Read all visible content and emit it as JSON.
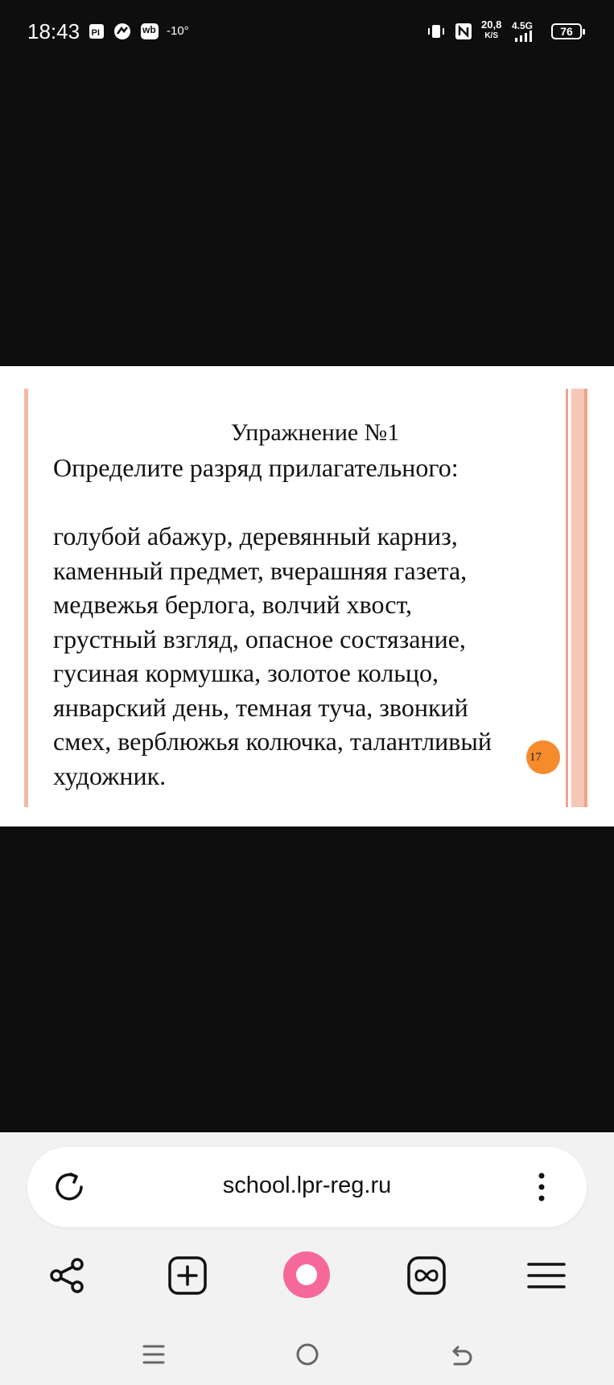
{
  "status_bar": {
    "time": "18:43",
    "notif_icons": [
      "pdf-app-icon",
      "sync-app-icon",
      "wb-app-icon"
    ],
    "wb_label": "wb",
    "temperature": "-10°",
    "speed_value": "20,8",
    "speed_unit": "K/S",
    "network": "4.5G",
    "battery": "76"
  },
  "slide": {
    "title": "Упражнение  №1",
    "question": "Определите  разряд прилагательного:",
    "lines": [
      "голубой абажур, деревянный карниз,",
      "каменный предмет, вчерашняя газета,",
      "медвежья берлога, волчий хвост,",
      "грустный взгляд, опасное состязание,",
      "гусиная кормушка, золотое кольцо,",
      "январский день, темная туча, звонкий",
      "смех, верблюжья колючка, талантливый",
      "художник."
    ],
    "page_number": "17",
    "accent_color": "#f68b2e"
  },
  "browser": {
    "url": "school.lpr-reg.ru",
    "toolbar": [
      "share-icon",
      "new-tab-icon",
      "alice-assistant-icon",
      "tabs-icon",
      "menu-icon"
    ],
    "alice_color": "#f7689a"
  },
  "system_nav": [
    "recent-apps-icon",
    "home-icon",
    "back-icon"
  ]
}
